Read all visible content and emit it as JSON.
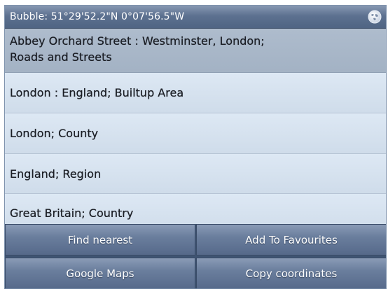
{
  "header": {
    "title": "Bubble: 51°29'52.2\"N 0°07'56.5\"W",
    "globe_icon": "globe-icon"
  },
  "results": [
    {
      "line1": "Abbey Orchard Street : Westminster, London;",
      "line2": "Roads and Streets",
      "selected": true
    },
    {
      "line1": "London : England; Builtup Area"
    },
    {
      "line1": "London; County"
    },
    {
      "line1": "England; Region"
    },
    {
      "line1": "Great Britain; Country"
    }
  ],
  "actions": {
    "find_nearest": "Find nearest",
    "add_favourites": "Add To Favourites",
    "google_maps": "Google Maps",
    "copy_coordinates": "Copy coordinates"
  },
  "colors": {
    "header": "#5d7190",
    "list_bg": "#d3e1f0",
    "selected_bg": "#a3b2c4",
    "button": "#6a7e9d"
  }
}
